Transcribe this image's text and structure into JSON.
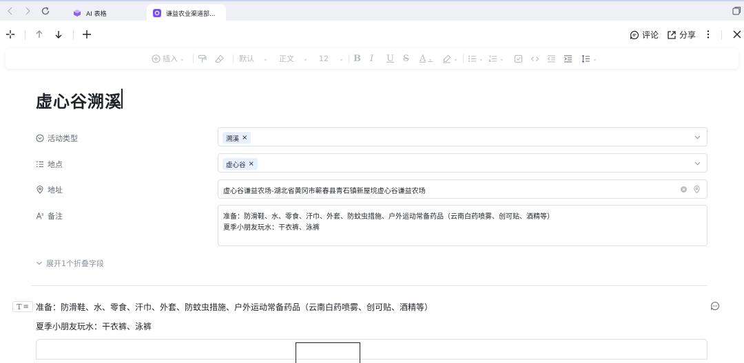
{
  "browser": {
    "tabs": [
      {
        "label": "AI 表格",
        "icon": "ai-table-icon",
        "active": false,
        "color": "#8b5cf6"
      },
      {
        "label": "谦益农业渠道部...",
        "icon": "app-icon",
        "active": true,
        "color": "#7c4dff"
      }
    ]
  },
  "doc_toolbar": {
    "comment_label": "评论",
    "share_label": "分享"
  },
  "format_toolbar": {
    "insert_label": "插入",
    "style_label": "默认",
    "paragraph_label": "正文",
    "font_size": "12"
  },
  "record": {
    "title": "虚心谷溯溪",
    "fields": {
      "activity_type": {
        "label": "活动类型",
        "tag": "溯溪"
      },
      "location": {
        "label": "地点",
        "tag": "虚心谷"
      },
      "address": {
        "label": "地址",
        "value": "虚心谷谦益农场-湖北省黄冈市蕲春县青石镇新屋垸虚心谷谦益农场"
      },
      "notes": {
        "label": "备注",
        "line1": "准备：防滑鞋、水、零食、汗巾、外套、防蚊虫措施、户外运动常备药品（云南白药喷雾、创可贴、酒精等）",
        "line2": "夏季小朋友玩水：干衣裤、泳裤"
      }
    },
    "expand_label": "展开1个折叠字段"
  },
  "body": {
    "line1": "准备：防滑鞋、水、零食、汗巾、外套、防蚊虫措施、户外运动常备药品（云南白药喷雾、创可贴、酒精等）",
    "line2": "夏季小朋友玩水：干衣裤、泳裤"
  },
  "colors": {
    "tag_bg": "#e8efff",
    "tab_strip_bg": "#eef0f5",
    "accent": "#7c4dff"
  }
}
